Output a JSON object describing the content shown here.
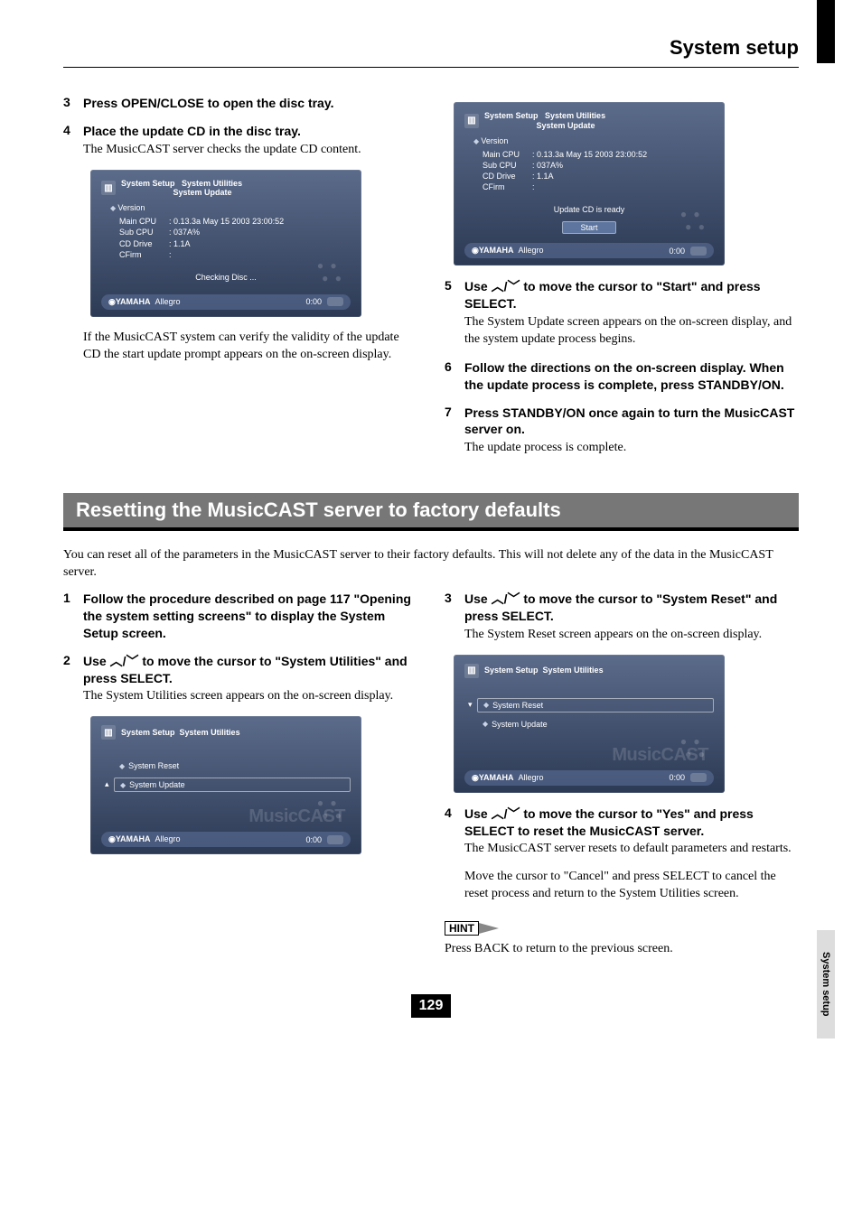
{
  "header": {
    "title": "System setup"
  },
  "side_tab": "System setup",
  "top": {
    "left": {
      "steps": [
        {
          "num": "3",
          "bold": "Press OPEN/CLOSE to open the disc tray."
        },
        {
          "num": "4",
          "bold": "Place the update CD in the disc tray.",
          "sub": "The MusicCAST server checks the update CD content."
        }
      ],
      "note": "If the MusicCAST system can verify the validity of the update CD the start update prompt appears on the on-screen display."
    },
    "right": {
      "steps": [
        {
          "num": "5",
          "bold_a": "Use ",
          "bold_nav": "／",
          "bold_b": " to move the cursor to \"Start\" and press SELECT.",
          "sub": "The System Update screen appears on the on-screen display, and the system update process begins."
        },
        {
          "num": "6",
          "bold": "Follow the directions on the on-screen display. When the update process is complete, press STANDBY/ON."
        },
        {
          "num": "7",
          "bold": "Press STANDBY/ON once again to turn the MusicCAST server on.",
          "sub": "The update process is complete."
        }
      ]
    }
  },
  "osd1": {
    "crumb1": "System Setup",
    "crumb2a": "System Utilities",
    "crumb2b": "System Update",
    "section": "Version",
    "rows": [
      {
        "k": "Main CPU",
        "v": ": 0.13.3a May 15 2003 23:00:52"
      },
      {
        "k": "Sub CPU",
        "v": ": 037A%"
      },
      {
        "k": "CD Drive",
        "v": ": 1.1A"
      },
      {
        "k": "CFirm",
        "v": ":"
      }
    ],
    "status": "Checking Disc ...",
    "footer": {
      "brand": "YAMAHA",
      "track": "Allegro",
      "time": "0:00"
    }
  },
  "osd2": {
    "crumb1": "System Setup",
    "crumb2a": "System Utilities",
    "crumb2b": "System Update",
    "section": "Version",
    "rows": [
      {
        "k": "Main CPU",
        "v": ": 0.13.3a May 15 2003 23:00:52"
      },
      {
        "k": "Sub CPU",
        "v": ": 037A%"
      },
      {
        "k": "CD Drive",
        "v": ": 1.1A"
      },
      {
        "k": "CFirm",
        "v": ":"
      }
    ],
    "status": "Update CD is ready",
    "button": "Start",
    "footer": {
      "brand": "YAMAHA",
      "track": "Allegro",
      "time": "0:00"
    }
  },
  "band": "Resetting the MusicCAST server to factory defaults",
  "intro": "You can reset all of the parameters in the MusicCAST server to their factory defaults. This will not delete any of the data in the MusicCAST server.",
  "bottom": {
    "left": {
      "steps": [
        {
          "num": "1",
          "bold": "Follow the procedure described on page 117 \"Opening the system setting screens\" to display the System Setup screen."
        },
        {
          "num": "2",
          "bold_a": "Use ",
          "bold_b": " to move the cursor to \"System Utilities\" and press SELECT.",
          "sub": "The System Utilities screen appears on the on-screen display."
        }
      ]
    },
    "right": {
      "steps": [
        {
          "num": "3",
          "bold_a": "Use ",
          "bold_b": " to move the cursor to \"System Reset\" and press SELECT.",
          "sub": "The System Reset screen appears on the on-screen display."
        },
        {
          "num": "4",
          "bold_a": "Use ",
          "bold_b": " to move the cursor to \"Yes\" and press SELECT to reset the MusicCAST server.",
          "sub": "The MusicCAST server resets to default parameters and restarts."
        }
      ],
      "note": "Move the cursor to \"Cancel\" and press SELECT to cancel the reset process and return to the System Utilities screen.",
      "hint_label": "HINT",
      "hint_text": "Press BACK to return to the previous screen."
    }
  },
  "osd3": {
    "crumb1": "System Setup",
    "crumb2": "System Utilities",
    "items": [
      "System Reset",
      "System Update"
    ],
    "watermark": "MusicCAST",
    "footer": {
      "brand": "YAMAHA",
      "track": "Allegro",
      "time": "0:00"
    }
  },
  "osd4": {
    "crumb1": "System Setup",
    "crumb2": "System Utilities",
    "items": [
      "System Reset",
      "System Update"
    ],
    "watermark": "MusicCAST",
    "footer": {
      "brand": "YAMAHA",
      "track": "Allegro",
      "time": "0:00"
    }
  },
  "pagenum": "129"
}
